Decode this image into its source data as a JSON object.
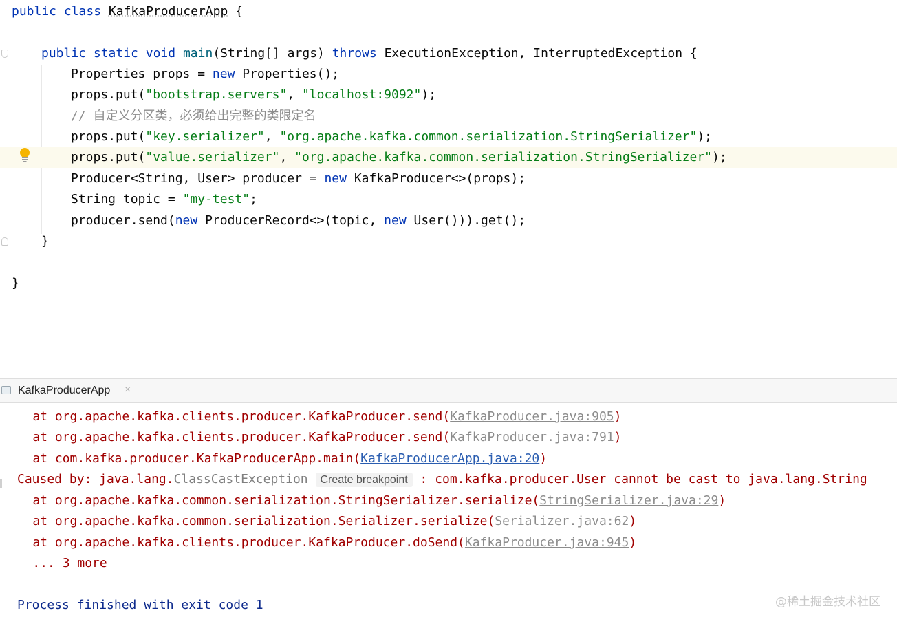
{
  "editor": {
    "lines": {
      "l1": {
        "kw1": "public",
        "kw2": "class",
        "cls": "KafkaProducerApp",
        "rest": " {"
      },
      "l3": {
        "kw1": "public",
        "kw2": "static",
        "kw3": "void",
        "fn": "main",
        "p1": "(String[] args) ",
        "kw4": "throws",
        "p2": " ExecutionException, InterruptedException {"
      },
      "l4": {
        "p1": "Properties props = ",
        "kw": "new",
        "p2": " Properties();"
      },
      "l5": {
        "p1": "props.put(",
        "s1": "\"bootstrap.servers\"",
        "p2": ", ",
        "s2": "\"localhost:9092\"",
        "p3": ");"
      },
      "l6": {
        "comment": "// 自定义分区类，必须给出完整的类限定名"
      },
      "l7": {
        "p1": "props.put(",
        "s1": "\"key.serializer\"",
        "p2": ", ",
        "s2": "\"org.apache.kafka.common.serialization.StringSerializer\"",
        "p3": ");"
      },
      "l8": {
        "p1": "props.put(",
        "s1": "\"value.serializer\"",
        "p2": ", ",
        "s2": "\"org.apache.kafka.common.serialization.StringSerializer\"",
        "p3": ");"
      },
      "l9": {
        "p1": "Producer<String, User> producer = ",
        "kw": "new",
        "p2": " KafkaProducer<>(props);"
      },
      "l10": {
        "p1": "String topic = ",
        "q1": "\"",
        "s": "my-test",
        "q2": "\"",
        "p2": ";"
      },
      "l11": {
        "p1": "producer.send(",
        "kw1": "new",
        "p2": " ProducerRecord<>(topic, ",
        "kw2": "new",
        "p3": " User())).get();"
      },
      "l12": {
        "p": "}"
      },
      "l14": {
        "p": "}"
      }
    }
  },
  "run_tab": {
    "label": "KafkaProducerApp",
    "close": "×"
  },
  "console": {
    "c1": {
      "p": "    at org.apache.kafka.clients.producer.KafkaProducer.send(",
      "link": "KafkaProducer.java:905",
      "e": ")"
    },
    "c2": {
      "p": "    at org.apache.kafka.clients.producer.KafkaProducer.send(",
      "link": "KafkaProducer.java:791",
      "e": ")"
    },
    "c3": {
      "p": "    at com.kafka.producer.KafkaProducerApp.main(",
      "link": "KafkaProducerApp.java:20",
      "e": ")"
    },
    "c4": {
      "p": "Caused by: java.lang.",
      "exc": "ClassCastException",
      "hint": "Create breakpoint",
      "e": " : com.kafka.producer.User cannot be cast to java.lang.String"
    },
    "c5": {
      "p": "    at org.apache.kafka.common.serialization.StringSerializer.serialize(",
      "link": "StringSerializer.java:29",
      "e": ")"
    },
    "c6": {
      "p": "    at org.apache.kafka.common.serialization.Serializer.serialize(",
      "link": "Serializer.java:62",
      "e": ")"
    },
    "c7": {
      "p": "    at org.apache.kafka.clients.producer.KafkaProducer.doSend(",
      "link": "KafkaProducer.java:945",
      "e": ")"
    },
    "c8": {
      "p": "    ... 3 more"
    },
    "c9": {
      "p": "Process finished with exit code 1"
    }
  },
  "watermark": "@稀土掘金技术社区",
  "colors": {
    "keyword": "#0033b3",
    "string": "#067d17",
    "comment": "#8c8c8c",
    "error": "#a00000",
    "link": "#2a5db0",
    "highlight": "#fcfaed"
  }
}
